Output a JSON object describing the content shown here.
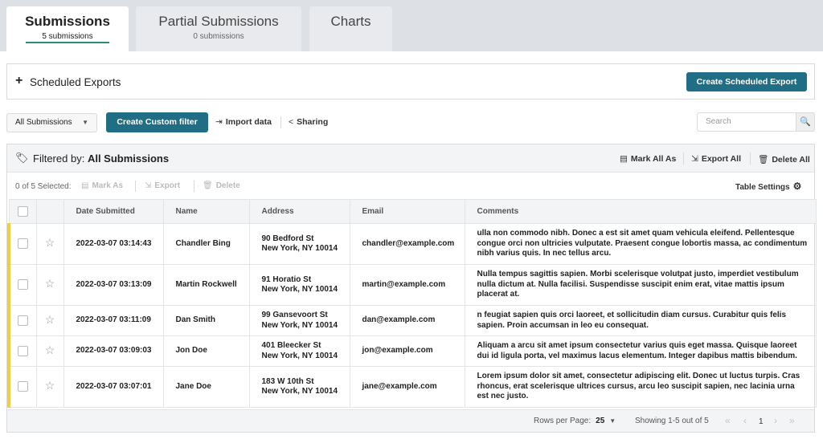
{
  "tabs": [
    {
      "title": "Submissions",
      "sub": "5 submissions"
    },
    {
      "title": "Partial Submissions",
      "sub": "0 submissions"
    },
    {
      "title": "Charts"
    }
  ],
  "scheduled": {
    "plus": "+",
    "label": "Scheduled Exports",
    "create_label": "Create Scheduled Export"
  },
  "toolbar": {
    "filter_value": "All Submissions",
    "create_filter_label": "Create Custom filter",
    "import_label": "Import data",
    "sharing_label": "Sharing",
    "search_placeholder": "Search"
  },
  "filter_bar": {
    "prefix": "Filtered by:",
    "value": "All Submissions",
    "mark_all": "Mark All As",
    "export_all": "Export All",
    "delete_all": "Delete All"
  },
  "selection": {
    "count": "0 of 5 Selected:",
    "mark_as": "Mark As",
    "export": "Export",
    "delete": "Delete",
    "table_settings": "Table Settings"
  },
  "table": {
    "columns": [
      "Date Submitted",
      "Name",
      "Address",
      "Email",
      "Comments"
    ],
    "rows": [
      {
        "date": "2022-03-07 03:14:43",
        "name": "Chandler Bing",
        "addr1": "90 Bedford St",
        "addr2": "New York, NY 10014",
        "email": "chandler@example.com",
        "comments": "ulla non commodo nibh. Donec a est sit amet quam vehicula eleifend. Pellentesque congue orci non ultricies vulputate. Praesent congue lobortis massa, ac condimentum nibh varius quis. In nec tellus arcu."
      },
      {
        "date": "2022-03-07 03:13:09",
        "name": "Martin Rockwell",
        "addr1": "91 Horatio St",
        "addr2": "New York, NY 10014",
        "email": "martin@example.com",
        "comments": "Nulla tempus sagittis sapien. Morbi scelerisque volutpat justo, imperdiet vestibulum nulla dictum at. Nulla facilisi. Suspendisse suscipit enim erat, vitae mattis ipsum placerat at."
      },
      {
        "date": "2022-03-07 03:11:09",
        "name": "Dan Smith",
        "addr1": "99 Gansevoort St",
        "addr2": "New York, NY 10014",
        "email": "dan@example.com",
        "comments": "n feugiat sapien quis orci laoreet, et sollicitudin diam cursus. Curabitur quis felis sapien. Proin accumsan in leo eu consequat."
      },
      {
        "date": "2022-03-07 03:09:03",
        "name": "Jon Doe",
        "addr1": "401 Bleecker St",
        "addr2": "New York, NY 10014",
        "email": "jon@example.com",
        "comments": "Aliquam a arcu sit amet ipsum consectetur varius quis eget massa. Quisque laoreet dui id ligula porta, vel maximus lacus elementum. Integer dapibus mattis bibendum."
      },
      {
        "date": "2022-03-07 03:07:01",
        "name": "Jane Doe",
        "addr1": "183 W 10th St",
        "addr2": "New York, NY 10014",
        "email": "jane@example.com",
        "comments": "Lorem ipsum dolor sit amet, consectetur adipiscing elit. Donec ut luctus turpis. Cras rhoncus, erat scelerisque ultrices cursus, arcu leo suscipit sapien, nec lacinia urna est nec justo."
      }
    ]
  },
  "pager": {
    "rows_per_page_label": "Rows per Page:",
    "rows_per_page": "25",
    "showing": "Showing 1-5 out of 5",
    "page": "1"
  },
  "icons": {
    "caret": "▼",
    "search": "🔍",
    "import": "⇥",
    "sharing": "<",
    "tag": "🏷",
    "mark": "▤",
    "export": "⇲",
    "delete": "🗑",
    "gear": "⚙",
    "star": "☆",
    "first": "«",
    "prev": "‹",
    "next": "›",
    "last": "»"
  },
  "colors": {
    "accent": "#1f6e86",
    "underline": "#2f8c7c",
    "row_marker": "#f2ce3c"
  }
}
